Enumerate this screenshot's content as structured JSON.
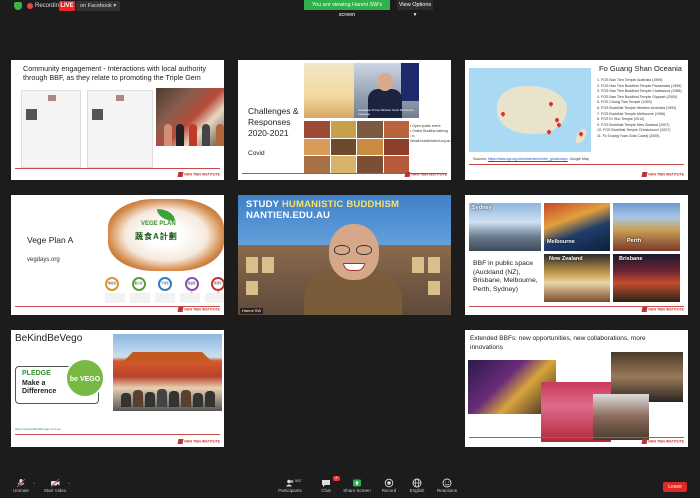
{
  "topbar": {
    "recording_label": "Recording",
    "live_label": "LIVE",
    "platform_label": "on Facebook",
    "share_banner": "You are viewing Hanmi SW's screen",
    "view_options": "View Options"
  },
  "tiles": {
    "community": {
      "title": "Community engagement - Interactions with local authority through BBF, as they relate to promoting the Triple Gem"
    },
    "covid": {
      "title_line1": "Challenges &",
      "title_line2": "Responses",
      "title_line3": "2020-2021",
      "subtitle": "Covid",
      "caption": "Australian Prime Minister Scott Morrison's message",
      "bullets": [
        "Open public event",
        "Online Buddha bathing",
        "e-Vesak.buddhistcivil.org.au"
      ]
    },
    "oceania": {
      "title": "Fo Guang Shan Oceania",
      "temples": [
        "1.  FGS Nan Tien Temple Australia (1995)",
        "2.  FGS Nan Tien Buddhist Temple Parramatta (1995)",
        "3.  FGS Nan Tien Buddhist Temple Chatswood (1996)",
        "4.  FGS Nan Tien Buddhist Temple Gippsah (2000)",
        "5.  FGS Chung Tian Temple (1993)",
        "6.  FGS Buddhist Temple Western Australia (1993)",
        "7.  FGS Buddhist Temple Melbourne (1996)",
        "8.  FGS Er Shu Temple (2012)",
        "9.  FGS Buddhist Temple New Zealand (2007)",
        "10. FGS Buddhist Temple Christchurch (2007)",
        "11. Fo Guang Yuan Gold Coast) (2005)"
      ],
      "sources_label": "Sources:",
      "sources_link": "https://www.fgs.org.tw/en/center/center_global.aspx",
      "sources_suffix": ", Google Map"
    },
    "vege": {
      "title": "Vege Plan A",
      "site": "vegdays.org",
      "logo_en": "VEGE PLAN",
      "logo_zh": "蔬食A計劃",
      "circle_labels": [
        "轉意識",
        "勸止殺",
        "不食生",
        "保護環境",
        "健康生活"
      ]
    },
    "video": {
      "banner_line1": "STUDY HUMANISTIC BUDDHISM",
      "banner_highlight": "HUMANISTIC BUDDHISM",
      "banner_line2": "NANTIEN.EDU.AU",
      "name": "Hanmi SW"
    },
    "bbf": {
      "text": "BBF in public space (Auckland (NZ), Brisbane, Melbourne, Perth, Sydney)",
      "photo_labels": [
        "Sydney",
        "Melbourne",
        "Perth",
        "New Zealand",
        "Brisbane"
      ]
    },
    "bekind": {
      "title": "BeKindBeVego",
      "pledge_line1": "PLEDGE",
      "pledge_line2": "Make a",
      "pledge_line3": "Difference",
      "vego_label": "be VEGO",
      "link": "https://www.bekindbevego.com.au"
    },
    "extended": {
      "title": "Extended BBFs: new opportunities, new collaborations, more innovations"
    },
    "logo_text": "NAN TIEN INSTITUTE"
  },
  "toolbar": {
    "unmute": "Unmute",
    "start_video": "Start Video",
    "participants": "Participants",
    "participants_count": "597",
    "chat": "Chat",
    "chat_badge": "8",
    "share_screen": "Share Screen",
    "record": "Record",
    "english": "English",
    "reactions": "Reactions",
    "leave": "Leave"
  },
  "colors": {
    "accent_red": "#c84c4c",
    "share_green": "#2fb24a",
    "leave_red": "#e02828"
  }
}
